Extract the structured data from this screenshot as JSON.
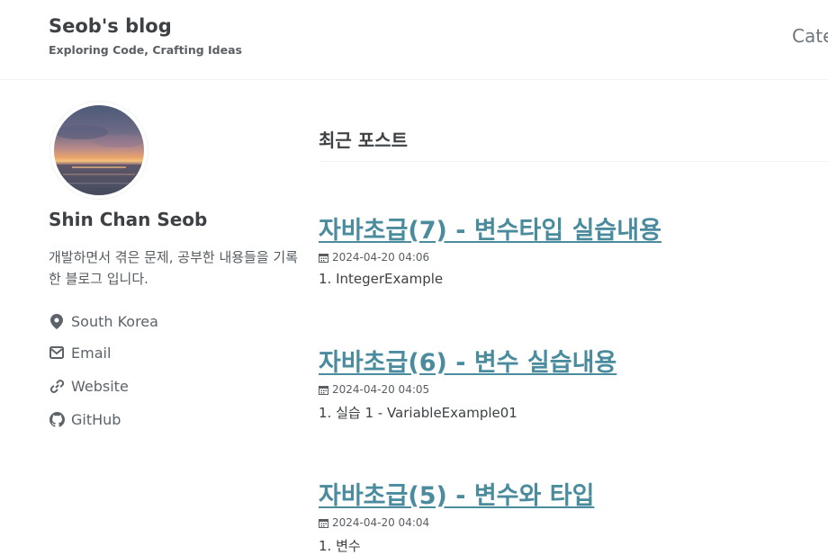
{
  "header": {
    "site_title": "Seob's blog",
    "site_subtitle": "Exploring Code, Crafting Ideas",
    "nav": [
      "Cate"
    ]
  },
  "sidebar": {
    "author_name": "Shin Chan Seob",
    "bio": "개발하면서 겪은 문제, 공부한 내용들을 기록한 블로그 입니다.",
    "links": [
      {
        "icon": "location-icon",
        "label": "South Korea"
      },
      {
        "icon": "email-icon",
        "label": "Email"
      },
      {
        "icon": "link-icon",
        "label": "Website"
      },
      {
        "icon": "github-icon",
        "label": "GitHub"
      }
    ]
  },
  "main": {
    "section_title": "최근 포스트",
    "posts": [
      {
        "title": "자바초급(7) - 변수타입 실습내용",
        "date": "2024-04-20 04:06",
        "excerpt": "1. IntegerExample"
      },
      {
        "title": "자바초급(6) - 변수 실습내용",
        "date": "2024-04-20 04:05",
        "excerpt": "1. 실습 1 - VariableExample01"
      },
      {
        "title": "자바초급(5) - 변수와 타입",
        "date": "2024-04-20 04:04",
        "excerpt": "1. 변수"
      }
    ]
  },
  "colors": {
    "link": "#4a8c9e",
    "text": "#3d4144",
    "muted": "#5c6369"
  }
}
